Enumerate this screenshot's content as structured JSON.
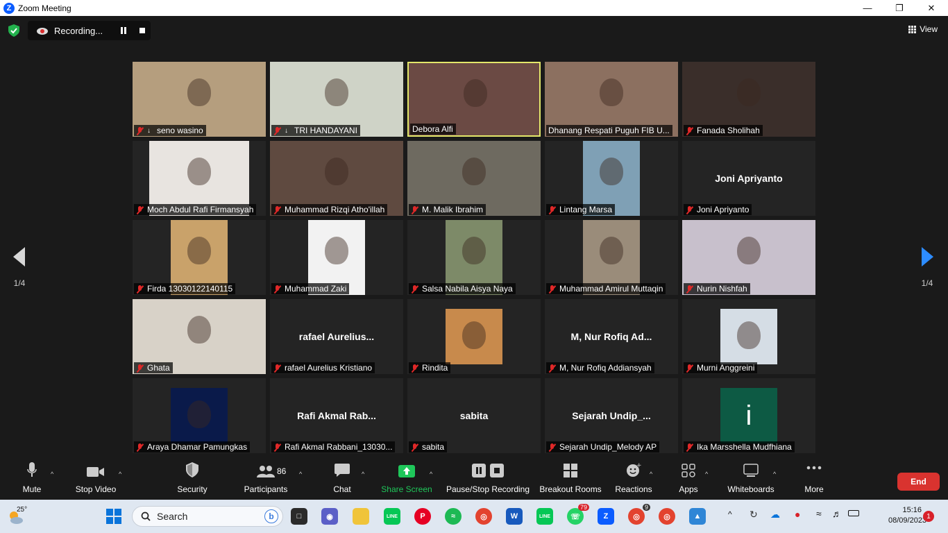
{
  "window": {
    "title": "Zoom Meeting"
  },
  "recording": {
    "label": "Recording..."
  },
  "view": {
    "label": "View"
  },
  "pager": {
    "left": "1/4",
    "right": "1/4"
  },
  "participants": [
    {
      "name": "seno wasino",
      "icon": "pin",
      "video": true,
      "bg": "#b59e7e",
      "w": 192
    },
    {
      "name": "TRI HANDAYANI",
      "icon": "pin",
      "video": true,
      "bg": "#cfd3c7",
      "w": 192
    },
    {
      "name": "Debora Alfi",
      "icon": "none",
      "video": true,
      "bg": "#6b4a44",
      "w": 192,
      "active": true
    },
    {
      "name": "Dhanang Respati Puguh FIB U...",
      "icon": "none",
      "video": true,
      "bg": "#8c7060",
      "w": 192
    },
    {
      "name": "Fanada Sholihah",
      "icon": "mic-off",
      "video": true,
      "bg": "#3a2e2a",
      "w": 192
    },
    {
      "name": "Moch Abdul Rafi Firmansyah",
      "icon": "mic-off",
      "video": true,
      "bg": "#e8e4e0",
      "w": 144
    },
    {
      "name": "Muhammad Rizqi Atho'illah",
      "icon": "mic-off",
      "video": true,
      "bg": "#5f4a40",
      "w": 192
    },
    {
      "name": "M. Malik Ibrahim",
      "icon": "mic-off",
      "video": true,
      "bg": "#6e6a60",
      "w": 192
    },
    {
      "name": "Lintang Marsa",
      "icon": "mic-off",
      "video": true,
      "bg": "#7fa0b5",
      "w": 82
    },
    {
      "name": "Joni Apriyanto",
      "icon": "mic-off",
      "video": false,
      "big": "Joni Apriyanto"
    },
    {
      "name": "Firda 13030122140115",
      "icon": "mic-off",
      "video": true,
      "bg": "#c9a26a",
      "w": 82
    },
    {
      "name": "Muhammad Zaki",
      "icon": "mic-off",
      "video": true,
      "bg": "#f2f2f2",
      "w": 82
    },
    {
      "name": "Salsa Nabila Aisya Naya",
      "icon": "mic-off",
      "video": true,
      "bg": "#7d8a68",
      "w": 82
    },
    {
      "name": "Muhammad Amirul Muttaqin",
      "icon": "mic-off",
      "video": true,
      "bg": "#9a8c7a",
      "w": 82
    },
    {
      "name": "Nurin Nishfah",
      "icon": "mic-off",
      "video": true,
      "bg": "#c8c0cc",
      "w": 192
    },
    {
      "name": "Ghata",
      "icon": "mic-off",
      "video": true,
      "bg": "#d8d2c8",
      "w": 192
    },
    {
      "name": "rafael Aurelius Kristiano",
      "icon": "mic-off",
      "video": false,
      "big": "rafael  Aurelius..."
    },
    {
      "name": "Rindita",
      "icon": "mic-off",
      "video": true,
      "bg": "#c88a4c",
      "w": 82
    },
    {
      "name": "M, Nur Rofiq Addiansyah",
      "icon": "mic-off",
      "video": false,
      "big": "M, Nur Rofiq Ad..."
    },
    {
      "name": "Murni Anggreini",
      "icon": "mic-off",
      "video": true,
      "bg": "#d5dde5",
      "w": 82
    },
    {
      "name": "Araya Dhamar Pamungkas",
      "icon": "mic-off",
      "video": true,
      "bg": "#0a1a4a",
      "w": 82
    },
    {
      "name": "Rafi Akmal Rabbani_13030...",
      "icon": "mic-off",
      "video": false,
      "big": "Rafi Akmal Rab..."
    },
    {
      "name": "sabita",
      "icon": "mic-off",
      "video": false,
      "big": "sabita"
    },
    {
      "name": "Sejarah Undip_Melody AP",
      "icon": "mic-off",
      "video": false,
      "big": "Sejarah  Undip_..."
    },
    {
      "name": "Ika Marsshella Mudfhiana",
      "icon": "mic-off",
      "video": true,
      "bg": "#0d5a44",
      "w": 82,
      "letter": "i"
    }
  ],
  "toolbar": {
    "mute": "Mute",
    "stop_video": "Stop Video",
    "security": "Security",
    "participants": "Participants",
    "participants_count": "86",
    "chat": "Chat",
    "share_screen": "Share Screen",
    "pause_recording": "Pause/Stop Recording",
    "breakout_rooms": "Breakout Rooms",
    "reactions": "Reactions",
    "apps": "Apps",
    "whiteboards": "Whiteboards",
    "more": "More",
    "end": "End"
  },
  "taskbar": {
    "weather_temp": "25°",
    "search_placeholder": "Search",
    "time": "15:16",
    "date": "08/09/2023",
    "notifications": "1",
    "whatsapp_badge": "79",
    "chrome_badge": "9"
  },
  "colors": {
    "accent_active": "#e4e86a",
    "share_green": "#1fc75a",
    "end_red": "#d9332f",
    "zoom_blue": "#0b5cff"
  }
}
